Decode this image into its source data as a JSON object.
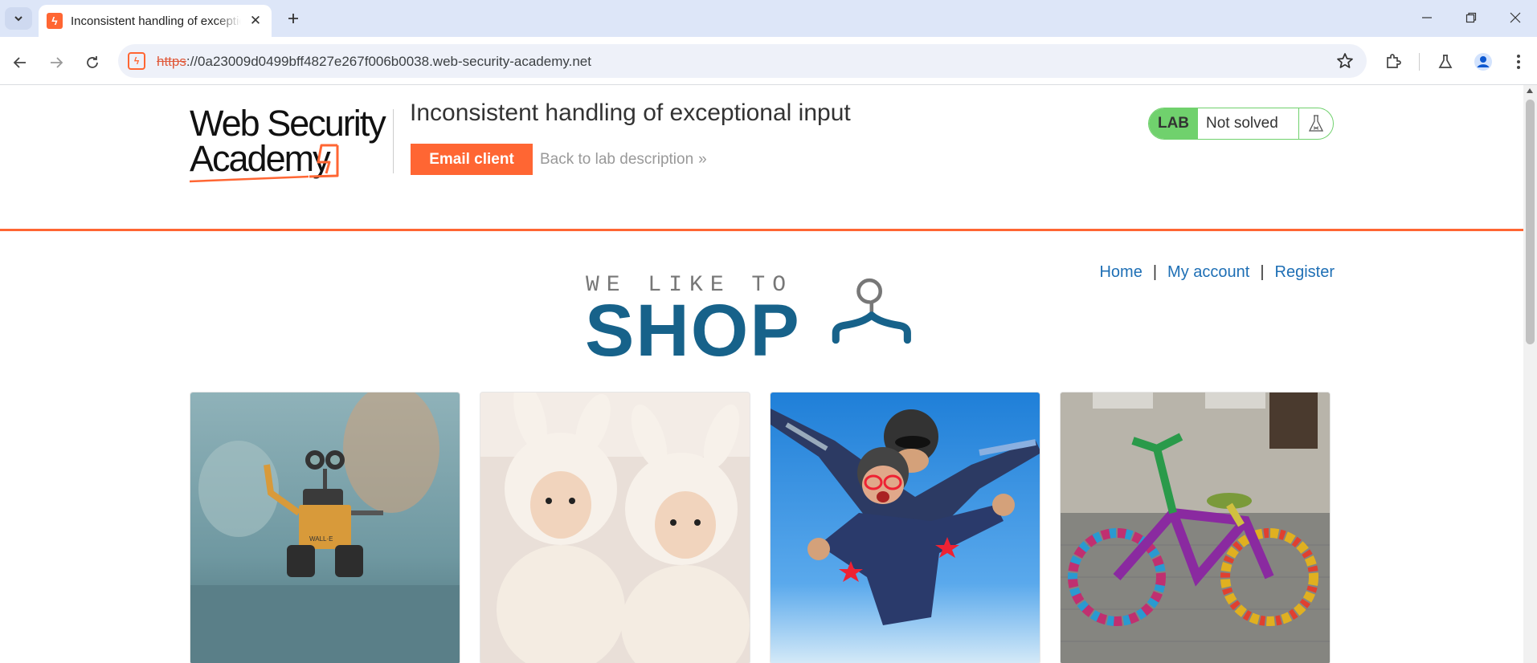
{
  "browser": {
    "tab_title": "Inconsistent handling of exceptional input",
    "url_scheme": "https",
    "url_rest": "://0a23009d0499bff4827e267f006b0038.web-security-academy.net"
  },
  "lab": {
    "logo_line1": "Web Security",
    "logo_line2": "Academy",
    "title": "Inconsistent handling of exceptional input",
    "email_client_label": "Email client",
    "back_link_label": "Back to lab description",
    "badge_label": "LAB",
    "status": "Not solved"
  },
  "nav": {
    "home": "Home",
    "my_account": "My account",
    "register": "Register",
    "separator": "|"
  },
  "banner": {
    "tagline": "WE LIKE TO",
    "word": "SHOP"
  },
  "colors": {
    "accent": "#ff6633",
    "lab_green": "#70d16d",
    "link_blue": "#1e6fb5",
    "shop_blue": "#17628a"
  }
}
